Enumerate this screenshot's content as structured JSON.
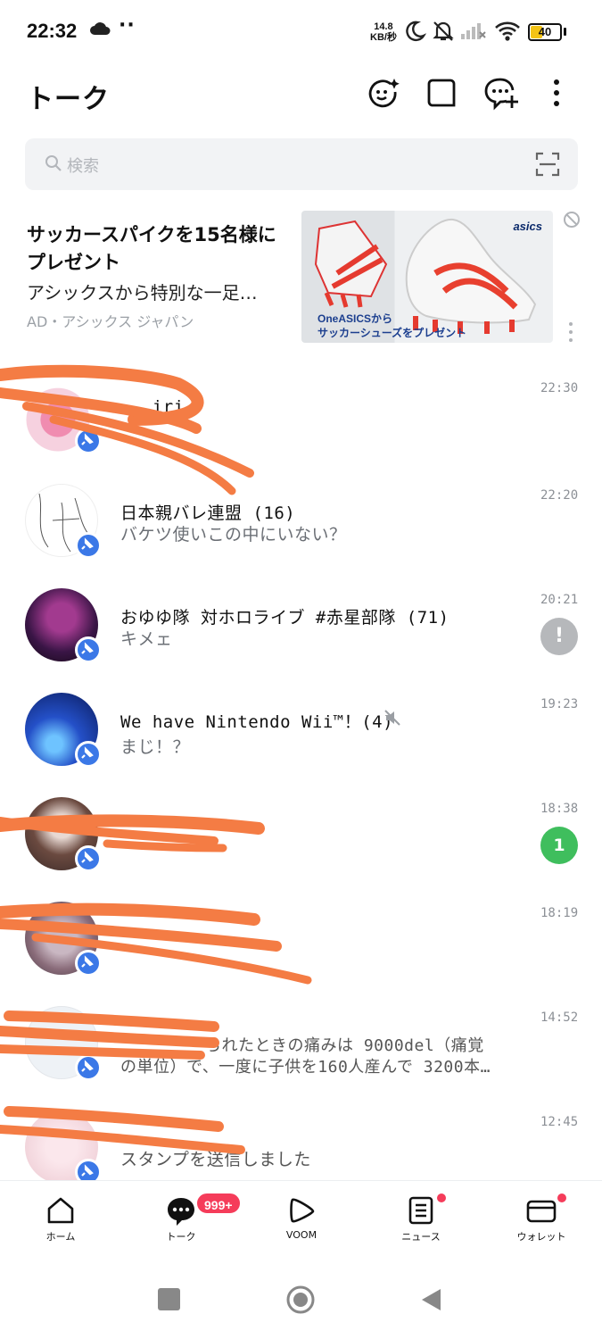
{
  "status_bar": {
    "time": "22:32",
    "dots": "··",
    "speed_value": "14.8",
    "speed_unit": "KB/秒",
    "battery": "40",
    "battery_level": 0.4
  },
  "header": {
    "title": "トーク",
    "icons": [
      "face-sparkle-icon",
      "square-chat-icon",
      "add-chat-icon",
      "more-vert-icon"
    ]
  },
  "search": {
    "placeholder": "検索",
    "icon": "search-icon",
    "scan_icon": "scan-icon"
  },
  "ad": {
    "title": "サッカースパイクを15名様にプレゼント",
    "description": "アシックスから特別な一足…",
    "meta": "AD・アシックス ジャパン",
    "image_brand": "asics",
    "image_caption_1": "OneASICSから",
    "image_caption_2": "サッカーシューズをプレゼント"
  },
  "chats": [
    {
      "name": "...iri",
      "message": "",
      "time": "22:30",
      "pinned": true,
      "badge": "",
      "avatar_color": "#f4c6d6"
    },
    {
      "name": "日本親バレ連盟 (16)",
      "message": "バケツ使いこの中にいない？",
      "time": "22:20",
      "pinned": true,
      "badge": "",
      "avatar_color": "#ffffff"
    },
    {
      "name": "おゆゆ隊 対ホロライブ #赤星部隊 (71)",
      "message": "キメェ",
      "time": "20:21",
      "pinned": true,
      "badge": "!",
      "avatar_color": "#3a1546"
    },
    {
      "name": "We have Nintendo Wii™！(4)",
      "message": "まじ！？",
      "time": "19:23",
      "pinned": true,
      "badge": "",
      "muted": true,
      "avatar_color": "#1f3fa8"
    },
    {
      "name": "",
      "message": "",
      "time": "18:38",
      "pinned": true,
      "badge": "1",
      "avatar_color": "#6b4a40"
    },
    {
      "name": "",
      "message": "",
      "time": "18:19",
      "pinned": true,
      "badge": "",
      "avatar_color": "#c9b7c2"
    },
    {
      "name": "",
      "message": "…られたときの痛みは 9000del（痛覚の単位）で、一度に子供を160人産んで 3200本…",
      "message_line1": "られたときの痛みは 9000del（痛覚",
      "message_line2": "の単位）で、一度に子供を160人産んで 3200本…",
      "time": "14:52",
      "pinned": true,
      "badge": "",
      "avatar_color": "#e8eef5"
    },
    {
      "name": "",
      "message": "スタンプを送信しました",
      "time": "12:45",
      "pinned": true,
      "badge": "",
      "avatar_color": "#f2d5dc"
    }
  ],
  "bottom_nav": [
    {
      "label": "ホーム",
      "icon": "home-icon",
      "dot": false
    },
    {
      "label": "トーク",
      "icon": "talk-icon",
      "count": "999+",
      "active": true
    },
    {
      "label": "VOOM",
      "icon": "voom-icon",
      "dot": false
    },
    {
      "label": "ニュース",
      "icon": "news-icon",
      "dot": true
    },
    {
      "label": "ウォレット",
      "icon": "wallet-icon",
      "dot": true
    }
  ],
  "colors": {
    "pin": "#3b78e7",
    "badge_green": "#3fbe5d",
    "badge_gray": "#b6b8bb",
    "scribble": "#f47c44",
    "alert_red": "#f53c5a"
  }
}
